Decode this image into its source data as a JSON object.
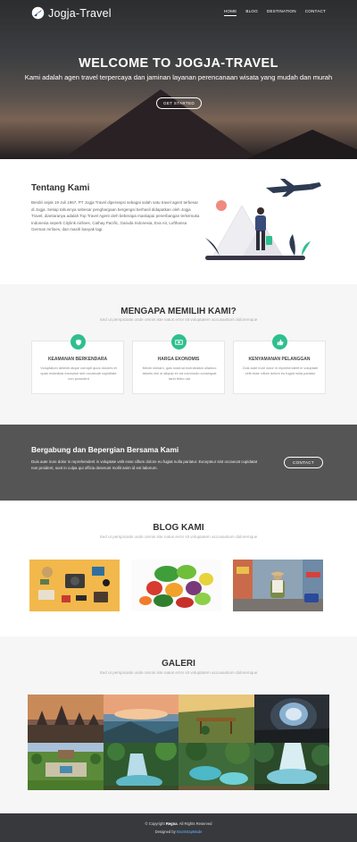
{
  "nav": {
    "brand": "Jogja-Travel",
    "items": [
      "HOME",
      "BLOG",
      "DESTINATION",
      "CONTACT"
    ],
    "active": "HOME"
  },
  "hero": {
    "title": "WELCOME TO JOGJA-TRAVEL",
    "subtitle": "Kami adalah agen travel terpercaya dan jaminan layanan perencanaan wisata yang mudah dan murah",
    "button": "GET STARTED"
  },
  "about": {
    "title": "Tentang Kami",
    "text": "Berdiri sejak 19 Juli 1967, PT Jogja Travel dipersepsi sebagai salah satu travel agent terbesar di Jogja. Setiap tahunnya sebesar penghargaan bergengsi berhasil didapatkan oleh Jogja Travel, diantaranya adalah Top Travel Agent oleh beberapa maskapai penerbangan terkemuka Indonesia seperti Citylink Airlines, Cathay Pacific, Garuda Indonesia, Eva Air, Lufthansa German Airlines, dan masih banyak lagi."
  },
  "why": {
    "title": "MENGAPA MEMILIH KAMI?",
    "subtitle": "Sed ut perspiciatis unde omnis iste natus error sit voluptatem accusantium doloremque",
    "cards": [
      {
        "title": "KEAMANAN BERKENDARA",
        "icon": "shield-icon",
        "text": "Voluptatum deleniti atque corrupti quos dolores et quas molestias excepturi sint occaecati cupiditate non provident"
      },
      {
        "title": "HARGA EKONOMIS",
        "icon": "money-icon",
        "text": "Minim veniam, quis nostrud exercitation ullamco laboris nisi ut aliquip ex ea commodo consequat tarid fetiro uta"
      },
      {
        "title": "KENYAMANAN PELANGGAN",
        "icon": "thumbs-up-icon",
        "text": "Duis aute irure dolor in reprehenderit in voluptate velit esse cillum dolore eu fugiat nulla pariatur"
      }
    ]
  },
  "join": {
    "title": "Bergabung dan Bepergian Bersama Kami",
    "text": "Duis aute irure dolor in reprehenderit in voluptate velit esse cillum dolore eu fugiat nulla pariatur. Excepteur sint occaecat cupidatat non proident, sunt in culpa qui officia deserunt mollit anim id est laborum.",
    "button": "CONTACT"
  },
  "blog": {
    "title": "BLOG KAMI",
    "subtitle": "Sed ut perspiciatis unde omnis iste natus error sit voluptatem accusantium doloremque"
  },
  "galeri": {
    "title": "GALERI",
    "subtitle": "Sed ut perspiciatis unde omnis iste natus error sit voluptatem accusantium doloremque"
  },
  "footer": {
    "copyright_prefix": "© Copyright",
    "owner": "Regna",
    "copyright_suffix": ". All Rights Reserved",
    "designed_prefix": "Designed by",
    "designer": "BootstrapMade"
  },
  "colors": {
    "accent": "#2fbf8e",
    "join_bg": "#555555",
    "footer_bg": "#37393c"
  }
}
